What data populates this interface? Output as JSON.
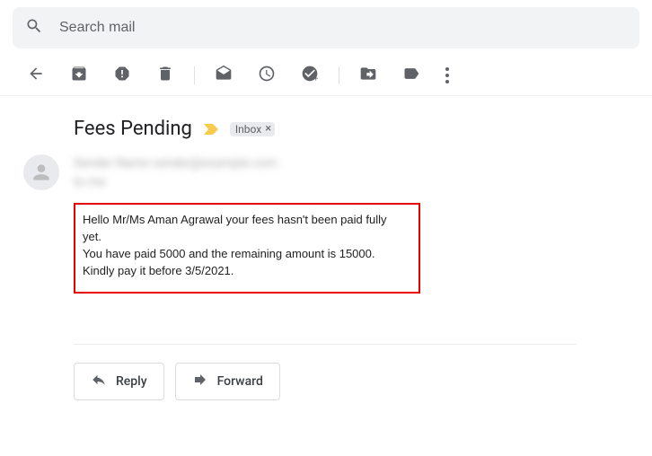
{
  "search": {
    "placeholder": "Search mail"
  },
  "subject": "Fees Pending",
  "label": {
    "name": "Inbox"
  },
  "sender": {
    "line1": "Sender Name sender@example.com",
    "line2": "to me"
  },
  "body": {
    "line1": "Hello Mr/Ms Aman Agrawal your fees hasn't been paid fully yet.",
    "line2": "You have paid 5000 and the remaining amount is 15000.",
    "line3": "Kindly pay it before 3/5/2021."
  },
  "actions": {
    "reply": "Reply",
    "forward": "Forward"
  }
}
